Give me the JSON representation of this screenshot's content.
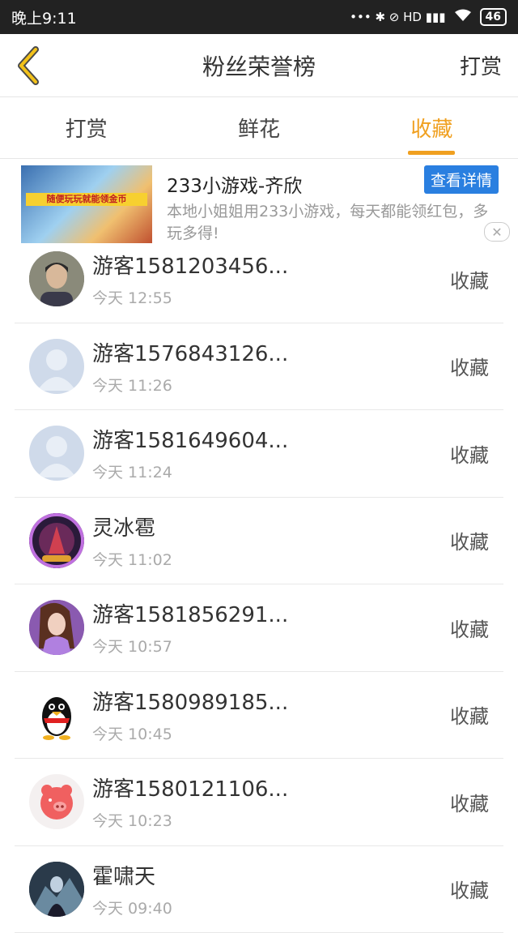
{
  "status_bar": {
    "time": "晚上9:11",
    "indicators": "••• ✱ ⊘ HD ▮▮▮",
    "battery": "46"
  },
  "nav": {
    "title": "粉丝荣誉榜",
    "action": "打赏"
  },
  "tabs": [
    {
      "label": "打赏",
      "active": false
    },
    {
      "label": "鲜花",
      "active": false
    },
    {
      "label": "收藏",
      "active": true
    }
  ],
  "ad": {
    "thumb_banner": "随便玩玩就能领金币",
    "title": "233小游戏-齐欣",
    "description": "本地小姐姐用233小游戏，每天都能领红包，多玩多得!",
    "button": "查看详情",
    "close": "✕"
  },
  "list": [
    {
      "name": "游客1581203456...",
      "date": "今天 12:55",
      "action": "收藏",
      "avatar": "photo-girl"
    },
    {
      "name": "游客1576843126...",
      "date": "今天 11:26",
      "action": "收藏",
      "avatar": "default-user"
    },
    {
      "name": "游客1581649604...",
      "date": "今天 11:24",
      "action": "收藏",
      "avatar": "default-user"
    },
    {
      "name": "灵冰雹",
      "date": "今天 11:02",
      "action": "收藏",
      "avatar": "game-character"
    },
    {
      "name": "游客1581856291...",
      "date": "今天 10:57",
      "action": "收藏",
      "avatar": "anime-woman"
    },
    {
      "name": "游客1580989185...",
      "date": "今天 10:45",
      "action": "收藏",
      "avatar": "qq-penguin"
    },
    {
      "name": "游客1580121106...",
      "date": "今天 10:23",
      "action": "收藏",
      "avatar": "pink-pig"
    },
    {
      "name": "霍啸天",
      "date": "今天 09:40",
      "action": "收藏",
      "avatar": "dark-fantasy"
    }
  ],
  "colors": {
    "accent": "#f0a020",
    "ad_button": "#2a7fe0",
    "status_bar": "#222222"
  }
}
